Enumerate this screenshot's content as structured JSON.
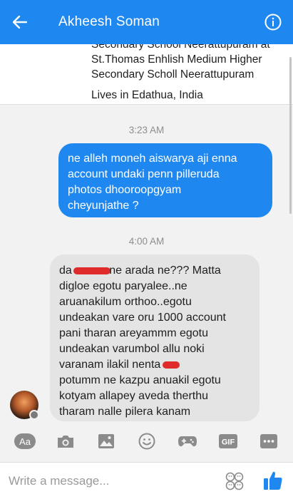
{
  "header": {
    "title": "Akheesh Soman",
    "back_icon": "back-arrow-icon",
    "info_icon": "info-icon",
    "color": "#1f88f0"
  },
  "profile": {
    "line_clipped": "Secondary School Neerattupuram at",
    "line1": "St.Thomas Enhlish Medium Higher",
    "line2": "Secondary Scholl Neerattupuram",
    "lives": "Lives in Edathua, India"
  },
  "messages": {
    "time1": "3:23 AM",
    "outgoing": [
      "ne alleh moneh aiswarya aji enna",
      "account undaki penn pilleruda",
      "photos dhooroopgyam",
      "cheyunjathe ?"
    ],
    "time2": "4:00 AM",
    "incoming": {
      "line1_a": "da",
      "line1_b": "ne arada ne??? Matta",
      "line2": "digloe egotu paryalee..ne",
      "line3": "aruanakilum orthoo..egotu",
      "line4": "undeakan vare oru 1000 account",
      "line5": "pani tharan areyammm egotu",
      "line6": "undeakan varumbol allu noki",
      "line7": "varanam ilakil nenta",
      "line8": "potumm ne kazpu anuakil egotu",
      "line9": "kotyam allapey aveda therthu",
      "line10": "tharam nalle pilera kanam"
    }
  },
  "toolbar": {
    "aa_label": "Aa",
    "gif_label": "GIF"
  },
  "composer": {
    "placeholder": "Write a message..."
  }
}
